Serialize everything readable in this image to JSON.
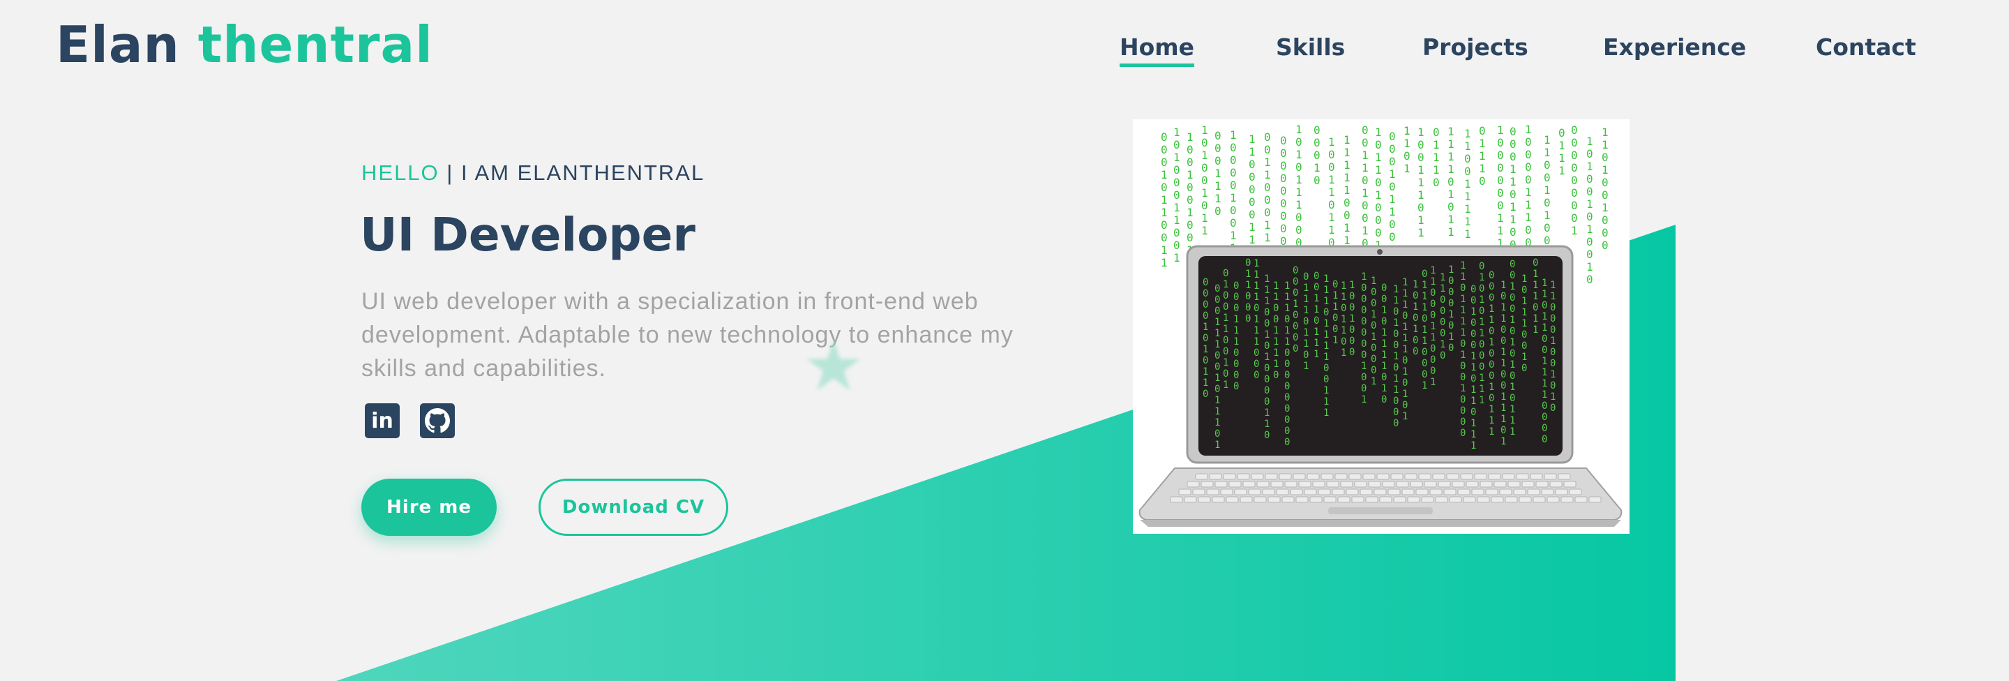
{
  "header": {
    "logo_first": "Elan",
    "logo_second": "thentral",
    "nav": [
      "Home",
      "Skills",
      "Projects",
      "Experience",
      "Contact"
    ],
    "active_nav": "Home"
  },
  "hero": {
    "greeting_highlight": "HELLO",
    "greeting_rest": "I AM ELANTHENTRAL",
    "title": "UI Developer",
    "description": "UI web developer with a specialization in front-end web development. Adaptable to new technology to enhance my skills and capabilities.",
    "social": [
      {
        "name": "linkedin-icon",
        "glyph": "in"
      },
      {
        "name": "github-icon",
        "glyph": ""
      }
    ],
    "hire_label": "Hire me",
    "cv_label": "Download CV"
  },
  "image": {
    "name": "laptop-binary-code-illustration"
  },
  "colors": {
    "accent": "#1cc49b",
    "navy": "#2b4460",
    "text_muted": "#a3a3a3",
    "background": "#f2f2f2"
  }
}
